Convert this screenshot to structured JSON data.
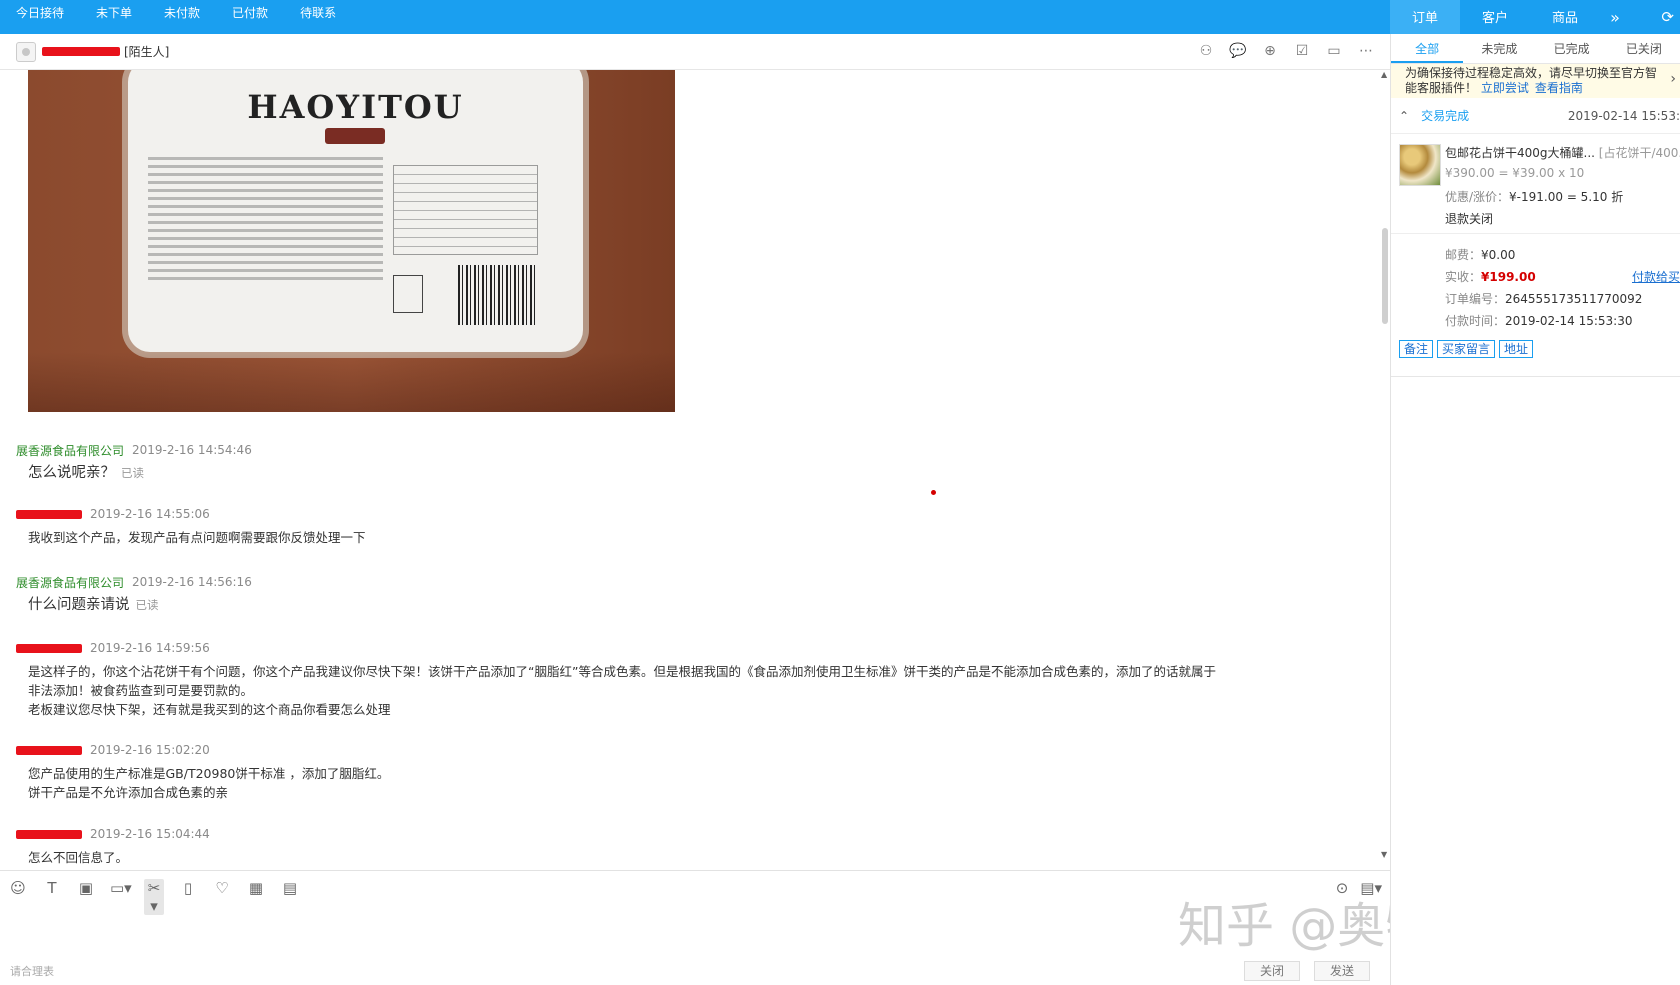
{
  "top_tabs": [
    "今日接待",
    "未下单",
    "未付款",
    "已付款",
    "待联系"
  ],
  "right_tabs": {
    "order": "订单",
    "customer": "客户",
    "product": "商品",
    "more": "»"
  },
  "chat_header": {
    "stranger_tag": "[陌生人]"
  },
  "messages": [
    {
      "sender": "展香源食品有限公司",
      "is_seller": true,
      "time": "2019-2-16 14:54:46",
      "text": "怎么说呢亲？",
      "read": "已读",
      "big": true
    },
    {
      "sender": "",
      "is_seller": false,
      "time": "2019-2-16 14:55:06",
      "text": "我收到这个产品，发现产品有点问题啊需要跟你反馈处理一下"
    },
    {
      "sender": "展香源食品有限公司",
      "is_seller": true,
      "time": "2019-2-16 14:56:16",
      "text": "什么问题亲请说",
      "read": "已读",
      "big": true
    },
    {
      "sender": "",
      "is_seller": false,
      "time": "2019-2-16 14:59:56",
      "text": "是这样子的，你这个沾花饼干有个问题，你这个产品我建议你尽快下架！该饼干产品添加了“胭脂红”等合成色素。但是根据我国的《食品添加剂使用卫生标准》饼干类的产品是不能添加合成色素的，添加了的话就属于非法添加！被食药监查到可是要罚款的。\n老板建议您尽快下架，还有就是我买到的这个商品你看要怎么处理"
    },
    {
      "sender": "",
      "is_seller": false,
      "time": "2019-2-16 15:02:20",
      "text": "您产品使用的生产标准是GB/T20980饼干标准   ，添加了胭脂红。\n饼干产品是不允许添加合成色素的亲"
    },
    {
      "sender": "",
      "is_seller": false,
      "time": "2019-2-16 15:04:44",
      "text": "怎么不回信息了。"
    }
  ],
  "product_image": {
    "brand": "HAOYITOU"
  },
  "composer": {
    "hint": "请合理表",
    "close": "关闭",
    "send": "发送"
  },
  "watermark": "知乎 @奥特曼爱吃肉",
  "right_panel": {
    "subtabs": [
      "全部",
      "未完成",
      "已完成",
      "已关闭"
    ],
    "notice_text": "为确保接待过程稳定高效，请尽早切换至官方智能客服插件！",
    "notice_link1": "立即尝试",
    "notice_link2": "查看指南",
    "order_status": "交易完成",
    "order_time": "2019-02-14 15:53:",
    "item_name": "包邮花占饼干400g大桶罐...",
    "item_tag": "[占花饼干/400...",
    "item_price": "¥390.00 = ¥39.00 x 10",
    "discount_label": "优惠/涨价：",
    "discount_value": "¥-191.00 = 5.10 折",
    "refund": "退款关闭",
    "shipping_label": "邮费：",
    "shipping_value": "¥0.00",
    "paid_label": "实收：",
    "paid_value": "¥199.00",
    "pay_link": "付款给买",
    "order_no_label": "订单编号：",
    "order_no": "264555173511770092",
    "pay_time_label": "付款时间：",
    "pay_time": "2019-02-14 15:53:30",
    "actions": [
      "备注",
      "买家留言",
      "地址"
    ]
  }
}
